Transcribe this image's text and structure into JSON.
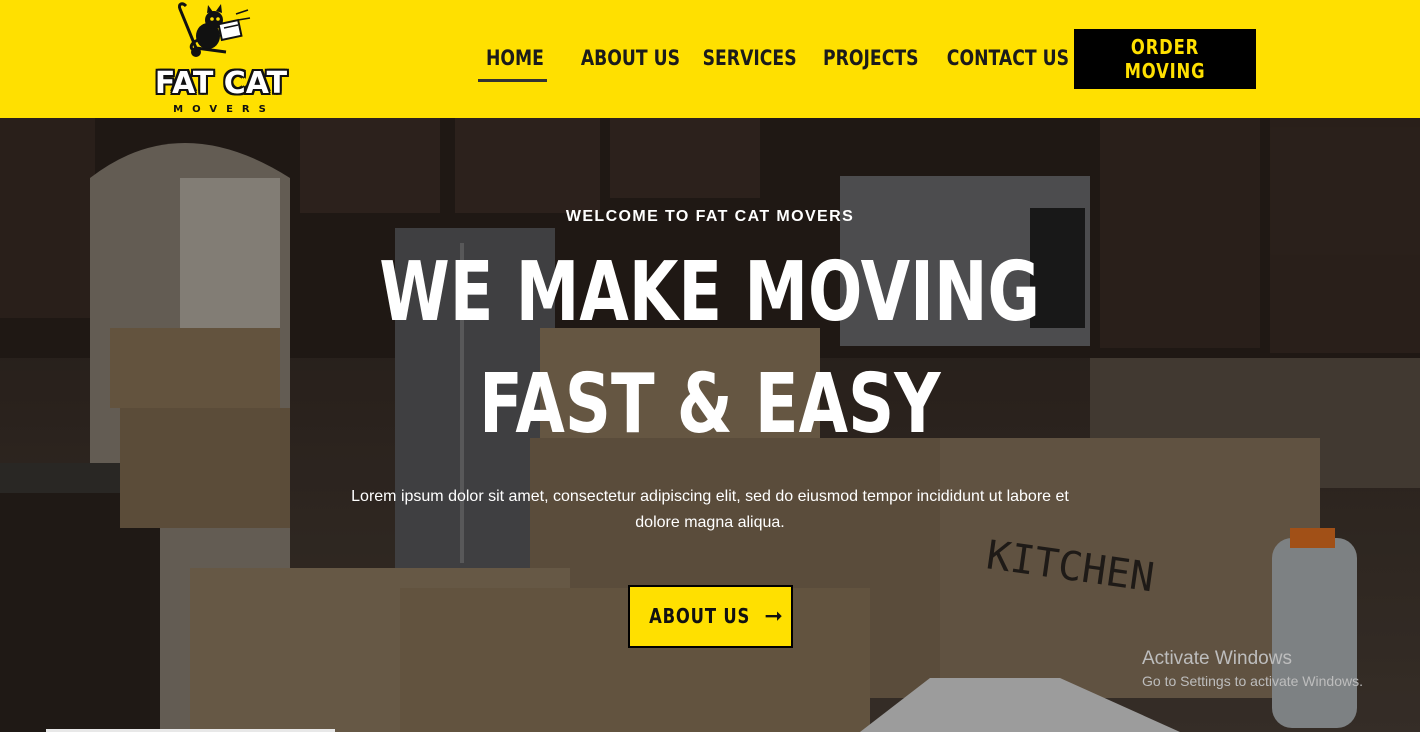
{
  "brand": {
    "logo_title": "FAT CAT",
    "logo_subtitle": "MOVERS"
  },
  "nav": {
    "items": [
      {
        "label": "HOME",
        "active": true
      },
      {
        "label": "ABOUT US",
        "active": false
      },
      {
        "label": "SERVICES",
        "active": false
      },
      {
        "label": "PROJECTS",
        "active": false
      },
      {
        "label": "CONTACT US",
        "active": false
      }
    ],
    "cta_label": "ORDER MOVING"
  },
  "hero": {
    "kicker": "WELCOME TO FAT CAT MOVERS",
    "headline_line1": "WE MAKE MOVING",
    "headline_line2": "FAST & EASY",
    "description": "Lorem ipsum dolor sit amet, consectetur adipiscing elit, sed do eiusmod tempor incididunt ut labore et dolore magna aliqua.",
    "button_label": "ABOUT US",
    "button_icon": "arrow-right-icon",
    "background_image": "kitchen-with-moving-boxes",
    "box_text": "KITCHEN"
  },
  "os_watermark": {
    "line1": "Activate Windows",
    "line2": "Go to Settings to activate Windows."
  },
  "colors": {
    "accent": "#ffe000",
    "dark": "#000000",
    "text_light": "#ffffff"
  }
}
